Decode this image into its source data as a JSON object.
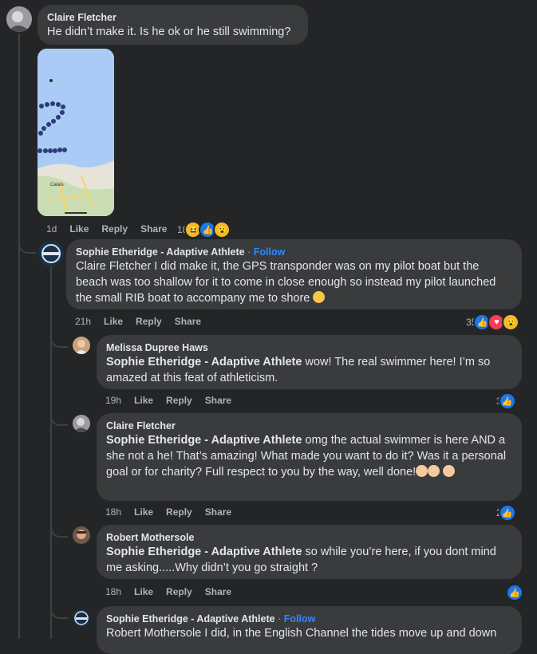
{
  "comments": [
    {
      "author": "Claire Fletcher",
      "text": "He didn’t make it. Is he ok or he still swimming?",
      "time": "1d",
      "like": "Like",
      "reply": "Reply",
      "share": "Share",
      "reaction_count": "18",
      "map_place": "Calais"
    },
    {
      "author": "Sophie Etheridge - Adaptive Athlete",
      "sep": "·",
      "follow": "Follow",
      "text": "Claire Fletcher I did make it, the GPS transponder was on my pilot boat but the beach was too shallow for it to come in close enough so instead my pilot launched the small RIB boat to accompany me to shore",
      "time": "21h",
      "like": "Like",
      "reply": "Reply",
      "share": "Share",
      "reaction_count": "35"
    },
    {
      "author": "Melissa Dupree Haws",
      "tag": "Sophie Etheridge - Adaptive Athlete",
      "text": " wow! The real swimmer here! I’m so amazed at this feat of athleticism.",
      "time": "19h",
      "like": "Like",
      "reply": "Reply",
      "share": "Share",
      "reaction_count": "3"
    },
    {
      "author": "Claire Fletcher",
      "tag": "Sophie Etheridge - Adaptive Athlete",
      "text": " omg the actual swimmer is here AND a she not a he! That’s amazing! What made you want to do it? Was it a personal goal or for charity? Full respect to you by the way, well done!",
      "time": "18h",
      "like": "Like",
      "reply": "Reply",
      "share": "Share",
      "reaction_count": "2"
    },
    {
      "author": "Robert Mothersole",
      "tag": "Sophie Etheridge - Adaptive Athlete",
      "text": " so while you’re here, if you dont mind me asking.....Why didn’t you go straight ?",
      "time": "18h",
      "like": "Like",
      "reply": "Reply",
      "share": "Share"
    },
    {
      "author": "Sophie Etheridge - Adaptive Athlete",
      "sep": "·",
      "follow": "Follow",
      "text": "Robert Mothersole I did, in the English Channel the tides move up and down"
    }
  ],
  "colors": {
    "background": "#242526",
    "bubble": "#3a3b3c",
    "link": "#2d88ff",
    "like": "#1877f2"
  }
}
